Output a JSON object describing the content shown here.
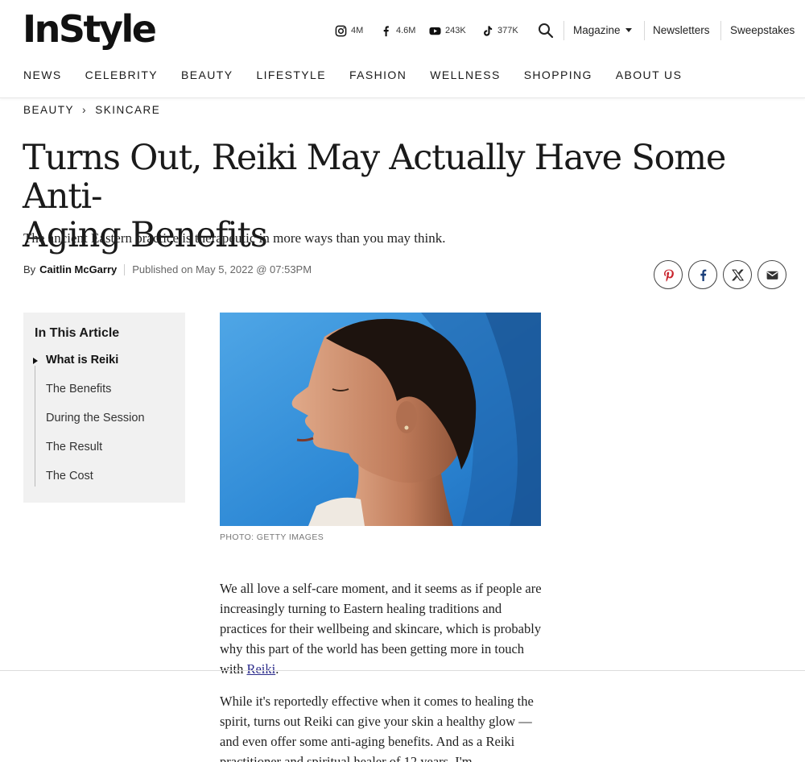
{
  "header": {
    "logo": "InStyle",
    "social": [
      {
        "icon": "instagram-icon",
        "count": "4M"
      },
      {
        "icon": "facebook-icon",
        "count": "4.6M"
      },
      {
        "icon": "youtube-icon",
        "count": "243K"
      },
      {
        "icon": "tiktok-icon",
        "count": "377K"
      }
    ],
    "magazine_label": "Magazine",
    "newsletters_label": "Newsletters",
    "sweepstakes_label": "Sweepstakes"
  },
  "nav": {
    "items": [
      "NEWS",
      "CELEBRITY",
      "BEAUTY",
      "LIFESTYLE",
      "FASHION",
      "WELLNESS",
      "SHOPPING",
      "ABOUT US"
    ]
  },
  "breadcrumb": {
    "items": [
      "BEAUTY",
      "SKINCARE"
    ]
  },
  "article": {
    "headline_line1": "Turns Out, Reiki May Actually Have Some Anti-",
    "headline_line2": "Aging Benefits",
    "dek": "The ancient Eastern practice is therapeutic in more ways than you may think.",
    "by_label": "By",
    "author": "Caitlin McGarry",
    "published": "Published on May 5, 2022 @ 07:53PM",
    "photo_credit": "PHOTO: GETTY IMAGES",
    "para1_before_link": "We all love a self-care moment, and it seems as if people are increasingly turning to Eastern healing traditions and practices for their wellbeing and skincare, which is probably why this part of the world has been getting more in touch with ",
    "para1_link": "Reiki",
    "para1_after_link": ".",
    "para2": "While it's reportedly effective when it comes to healing the spirit, turns out Reiki can give your skin a healthy glow — and even offer some anti-aging benefits. And as a Reiki practitioner and spiritual healer of 12 years, I'm"
  },
  "toc": {
    "title": "In This Article",
    "items": [
      "What is Reiki",
      "The Benefits",
      "During the Session",
      "The Result",
      "The Cost"
    ]
  },
  "share": {
    "icons": [
      "pinterest-icon",
      "facebook-icon",
      "x-icon",
      "email-icon"
    ]
  }
}
